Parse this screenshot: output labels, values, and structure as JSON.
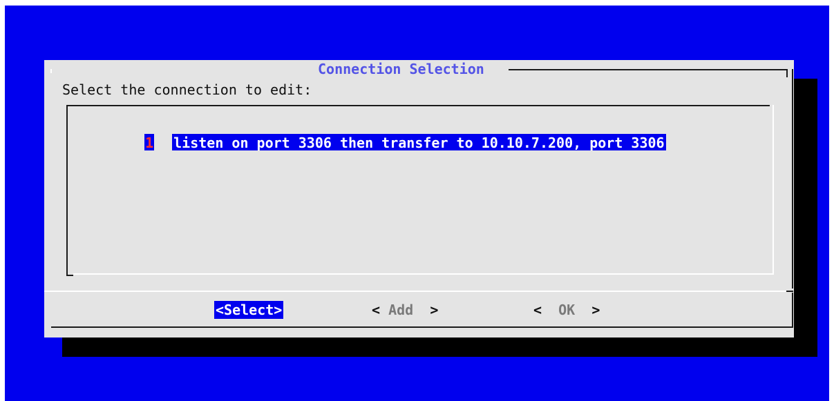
{
  "dialog": {
    "title": "Connection Selection",
    "prompt": "Select the connection to edit:",
    "items": [
      {
        "tag": "1",
        "label": "listen on port 3306 then transfer to 10.10.7.200, port 3306",
        "selected": true
      }
    ],
    "buttons": {
      "select": "<Select>",
      "add_left": "<",
      "add": "Add",
      "add_right": ">",
      "ok_left": "<",
      "ok": "OK",
      "ok_right": ">"
    }
  },
  "colors": {
    "background": "#0000ee",
    "dialog": "#e4e4e4",
    "title": "#5353e6",
    "highlight": "#0000ee",
    "tag": "#ff3030",
    "shadow": "#000000"
  }
}
